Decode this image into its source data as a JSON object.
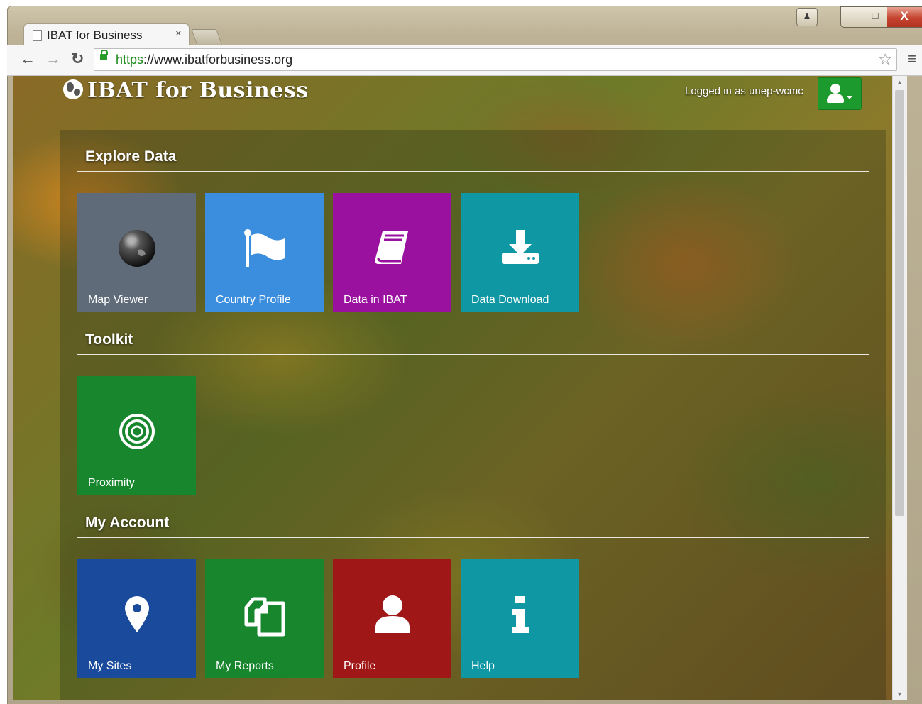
{
  "browser": {
    "tab_title": "IBAT for Business",
    "tab_close": "×",
    "url_scheme": "https",
    "url_rest": "://www.ibatforbusiness.org",
    "window_controls": {
      "minimize": "_",
      "maximize": "□",
      "close": "X"
    }
  },
  "header": {
    "brand": "IBAT for Business",
    "logged_in_text": "Logged in as unep-wcmc"
  },
  "sections": {
    "explore": {
      "title": "Explore Data",
      "tiles": [
        {
          "label": "Map Viewer",
          "icon": "globe-icon",
          "color": "#5f6b78"
        },
        {
          "label": "Country Profile",
          "icon": "flag-icon",
          "color": "#3b8ddd"
        },
        {
          "label": "Data in IBAT",
          "icon": "book-icon",
          "color": "#9a119f"
        },
        {
          "label": "Data Download",
          "icon": "download-icon",
          "color": "#0f97a3"
        }
      ]
    },
    "toolkit": {
      "title": "Toolkit",
      "tiles": [
        {
          "label": "Proximity",
          "icon": "target-icon",
          "color": "#17862d"
        }
      ]
    },
    "account": {
      "title": "My Account",
      "tiles": [
        {
          "label": "My Sites",
          "icon": "map-pin-icon",
          "color": "#1a4a9b"
        },
        {
          "label": "My Reports",
          "icon": "copy-icon",
          "color": "#17862d"
        },
        {
          "label": "Profile",
          "icon": "user-icon",
          "color": "#a01717"
        },
        {
          "label": "Help",
          "icon": "info-icon",
          "color": "#0f97a3"
        }
      ]
    }
  }
}
